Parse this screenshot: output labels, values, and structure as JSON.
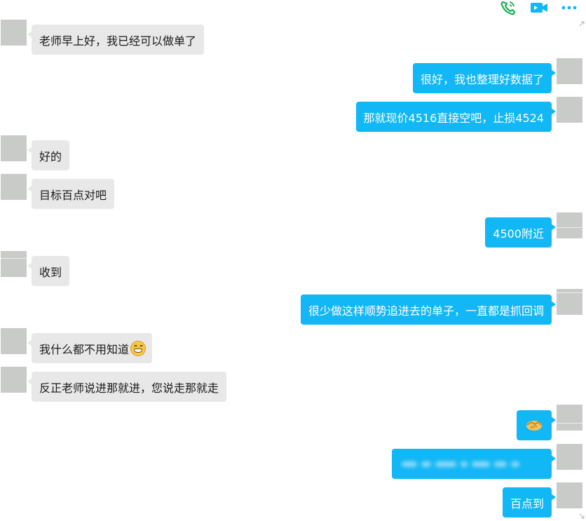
{
  "toolbar": {
    "phone_icon": "phone-call-icon",
    "video_icon": "video-call-icon",
    "more_icon": "more-icon",
    "phone_color": "#17b04f",
    "video_color": "#12b7f5"
  },
  "colors": {
    "outgoing_bubble": "#12b7f5",
    "incoming_bubble": "#e8e8e8",
    "avatar_placeholder": "#c9cbc8"
  },
  "messages": [
    {
      "side": "left",
      "text": "老师早上好，我已经可以做单了"
    },
    {
      "side": "right",
      "text": "很好，我也整理好数据了"
    },
    {
      "side": "right",
      "text": "那就现价4516直接空吧，止损4524"
    },
    {
      "side": "left",
      "text": "好的"
    },
    {
      "side": "left",
      "text": "目标百点对吧"
    },
    {
      "side": "right",
      "text": "4500附近"
    },
    {
      "side": "left",
      "text": "收到"
    },
    {
      "side": "right",
      "text": "很少做这样顺势追进去的单子，一直都是抓回调"
    },
    {
      "side": "left",
      "text": "我什么都不用知道",
      "emoji": "grinning-face-icon"
    },
    {
      "side": "left",
      "text": "反正老师说进那就进，您说走那就走"
    },
    {
      "side": "right",
      "emoji": "handshake-icon"
    },
    {
      "side": "right",
      "blurred": true
    },
    {
      "side": "right",
      "text": "百点到"
    }
  ]
}
